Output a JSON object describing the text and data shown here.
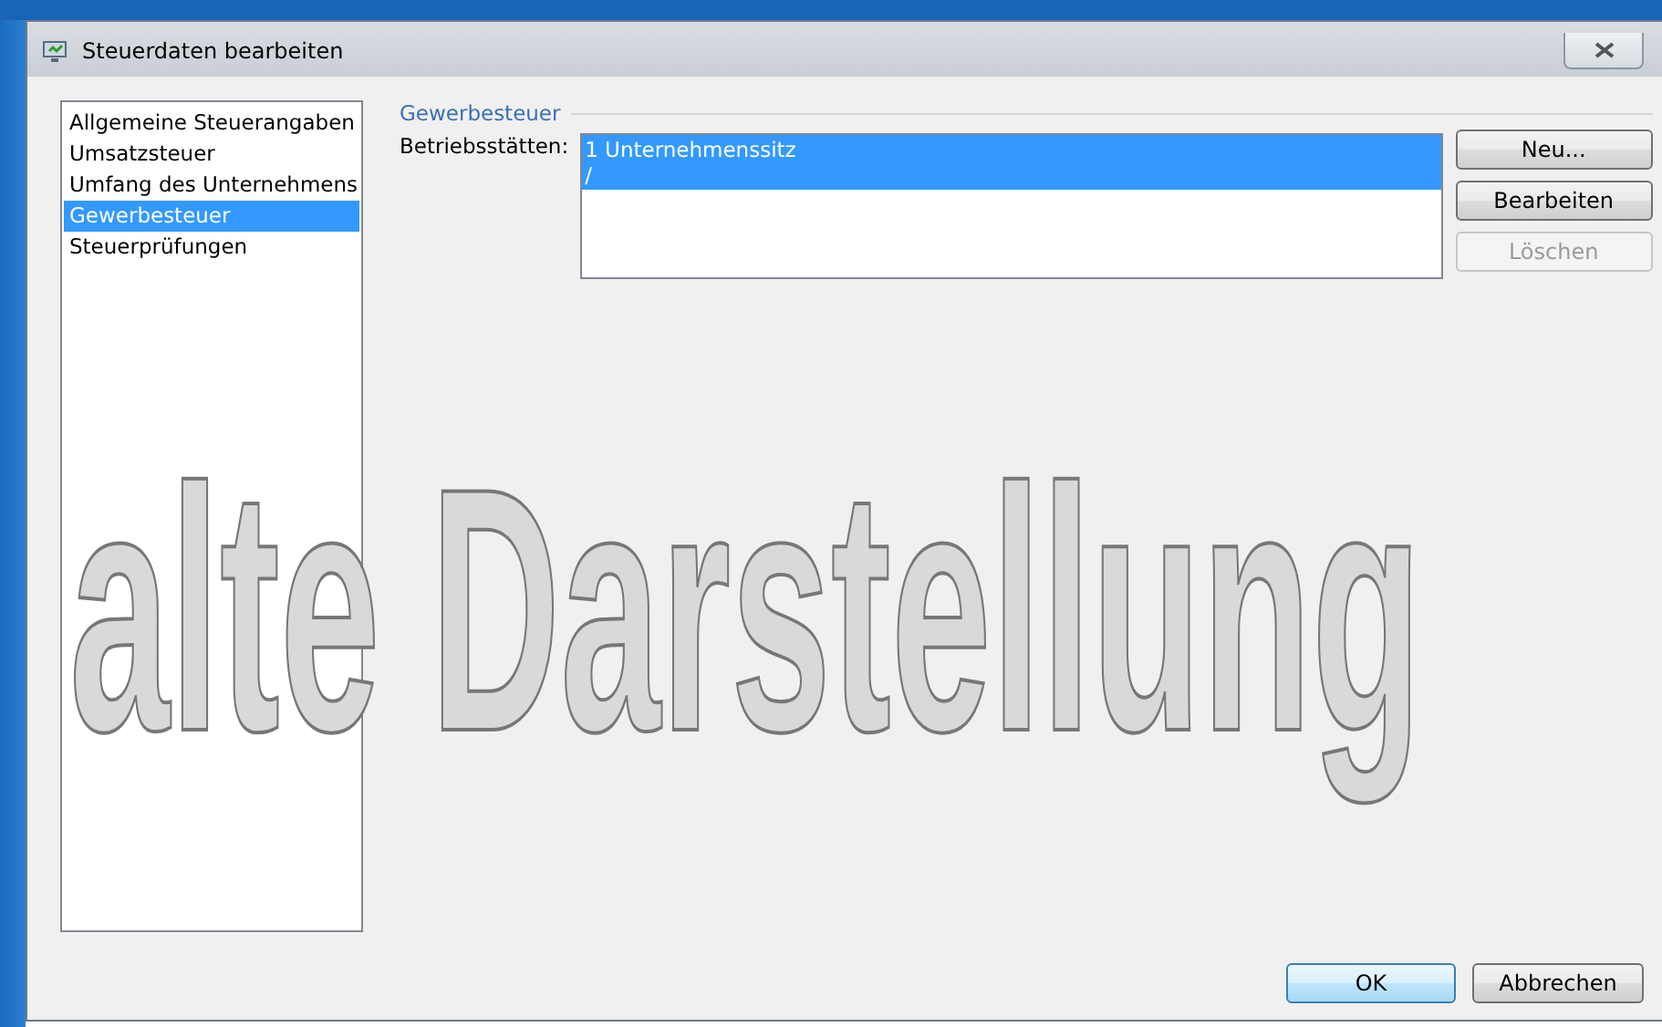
{
  "window": {
    "title": "Steuerdaten bearbeiten"
  },
  "sidebar": {
    "items": [
      {
        "label": "Allgemeine Steuerangaben",
        "selected": false
      },
      {
        "label": "Umsatzsteuer",
        "selected": false
      },
      {
        "label": "Umfang des Unternehmens",
        "selected": false
      },
      {
        "label": "Gewerbesteuer",
        "selected": true
      },
      {
        "label": "Steuerprüfungen",
        "selected": false
      }
    ]
  },
  "section": {
    "title": "Gewerbesteuer",
    "label": "Betriebsstätten:",
    "list": [
      {
        "lines": [
          "1 Unternehmenssitz",
          "/"
        ],
        "selected": true
      }
    ],
    "buttons": [
      {
        "label": "Neu...",
        "disabled": false
      },
      {
        "label": "Bearbeiten",
        "disabled": false
      },
      {
        "label": "Löschen",
        "disabled": true
      }
    ]
  },
  "footer": {
    "buttons": [
      {
        "label": "OK",
        "default": true
      },
      {
        "label": "Abbrechen",
        "default": false
      }
    ]
  },
  "overlay": {
    "text": "alte Darstellung"
  }
}
